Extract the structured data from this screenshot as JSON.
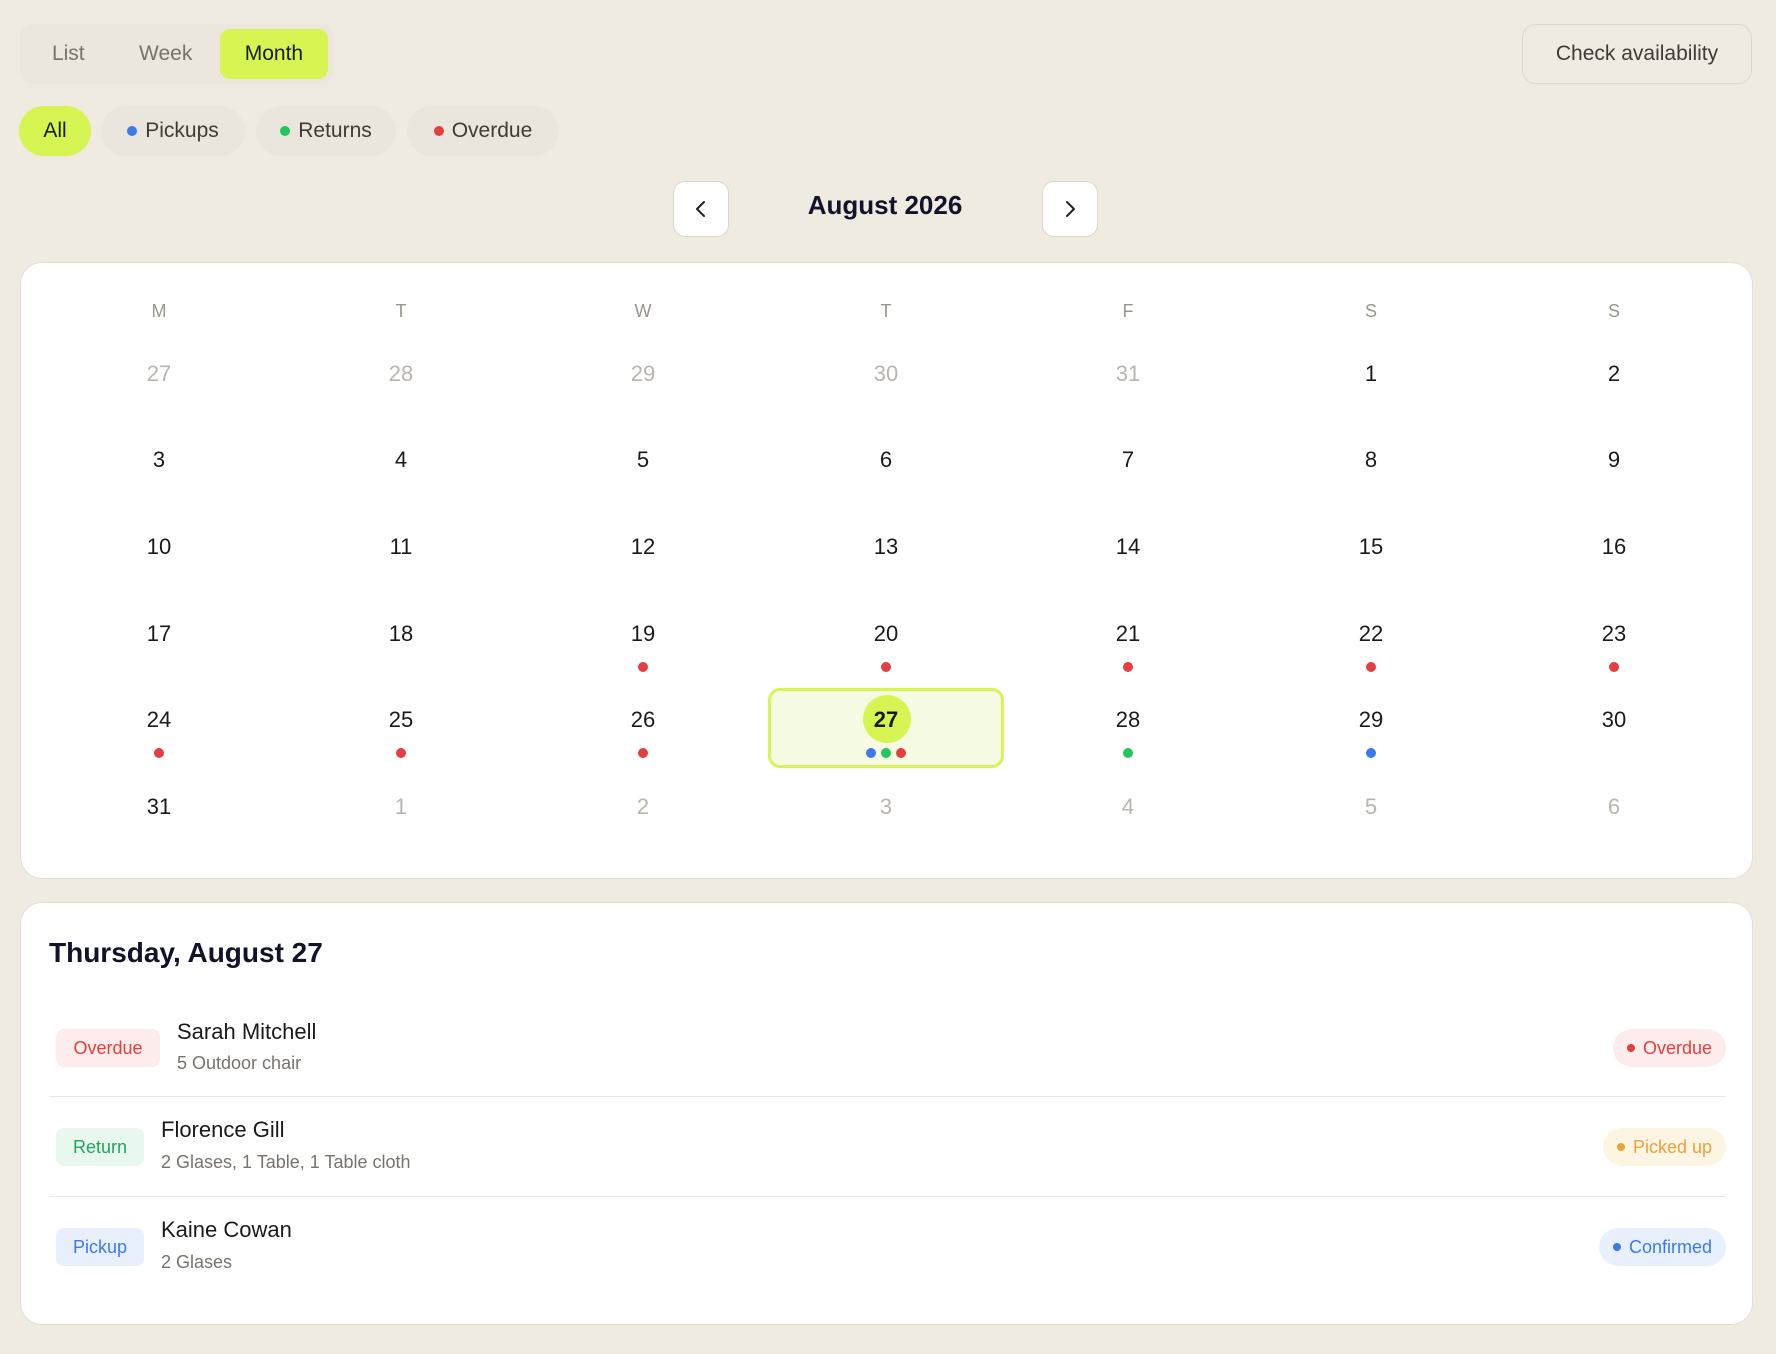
{
  "view_toggle": {
    "list": "List",
    "week": "Week",
    "month": "Month",
    "active": "Month"
  },
  "check_availability": "Check availability",
  "filters": {
    "all": "All",
    "pickups": "Pickups",
    "returns": "Returns",
    "overdue": "Overdue",
    "active": "All"
  },
  "colors": {
    "accent": "#d6f553",
    "pickup": "#3b7ae8",
    "return": "#22c55e",
    "overdue": "#e53e3e",
    "picked_up": "#e8a33a"
  },
  "month_title": "August 2026",
  "prev_icon": "chevron-left-icon",
  "next_icon": "chevron-right-icon",
  "weekdays": [
    "M",
    "T",
    "W",
    "T",
    "F",
    "S",
    "S"
  ],
  "weeks": [
    [
      {
        "d": "27",
        "muted": true
      },
      {
        "d": "28",
        "muted": true
      },
      {
        "d": "29",
        "muted": true
      },
      {
        "d": "30",
        "muted": true
      },
      {
        "d": "31",
        "muted": true
      },
      {
        "d": "1"
      },
      {
        "d": "2"
      }
    ],
    [
      {
        "d": "3"
      },
      {
        "d": "4"
      },
      {
        "d": "5"
      },
      {
        "d": "6"
      },
      {
        "d": "7"
      },
      {
        "d": "8"
      },
      {
        "d": "9"
      }
    ],
    [
      {
        "d": "10"
      },
      {
        "d": "11"
      },
      {
        "d": "12"
      },
      {
        "d": "13"
      },
      {
        "d": "14"
      },
      {
        "d": "15"
      },
      {
        "d": "16"
      }
    ],
    [
      {
        "d": "17"
      },
      {
        "d": "18"
      },
      {
        "d": "19",
        "dots": [
          "overdue"
        ]
      },
      {
        "d": "20",
        "dots": [
          "overdue"
        ]
      },
      {
        "d": "21",
        "dots": [
          "overdue"
        ]
      },
      {
        "d": "22",
        "dots": [
          "overdue"
        ]
      },
      {
        "d": "23",
        "dots": [
          "overdue"
        ]
      }
    ],
    [
      {
        "d": "24",
        "dots": [
          "overdue"
        ]
      },
      {
        "d": "25",
        "dots": [
          "overdue"
        ]
      },
      {
        "d": "26",
        "dots": [
          "overdue"
        ]
      },
      {
        "d": "27",
        "selected": true,
        "dots": [
          "pickup",
          "return",
          "overdue"
        ]
      },
      {
        "d": "28",
        "dots": [
          "return"
        ]
      },
      {
        "d": "29",
        "dots": [
          "pickup"
        ]
      },
      {
        "d": "30"
      }
    ],
    [
      {
        "d": "31"
      },
      {
        "d": "1",
        "muted": true
      },
      {
        "d": "2",
        "muted": true
      },
      {
        "d": "3",
        "muted": true
      },
      {
        "d": "4",
        "muted": true
      },
      {
        "d": "5",
        "muted": true
      },
      {
        "d": "6",
        "muted": true
      }
    ]
  ],
  "selected_date_title": "Thursday, August 27",
  "bookings": [
    {
      "type": "Overdue",
      "name": "Sarah Mitchell",
      "items": "5 Outdoor chair",
      "status": "Overdue"
    },
    {
      "type": "Return",
      "name": "Florence Gill",
      "items": "2 Glases, 1 Table, 1 Table cloth",
      "status": "Picked up"
    },
    {
      "type": "Pickup",
      "name": "Kaine Cowan",
      "items": "2 Glases",
      "status": "Confirmed"
    }
  ]
}
